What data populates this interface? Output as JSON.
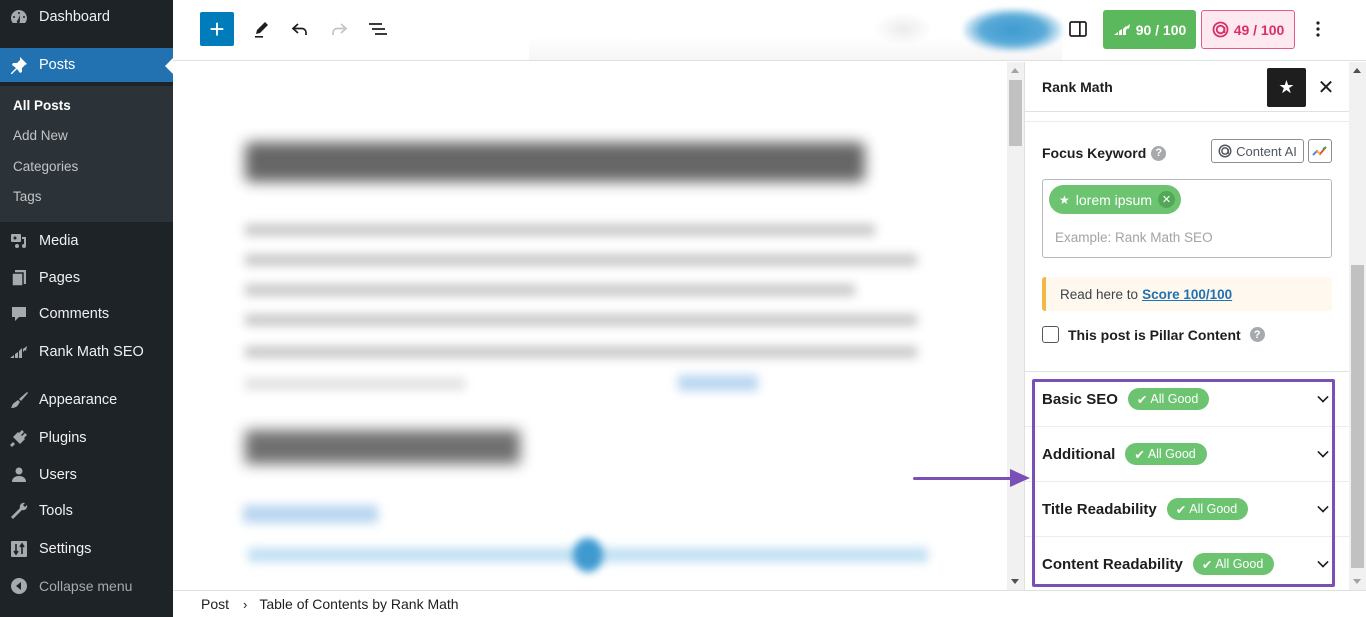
{
  "admin_menu": {
    "items": [
      {
        "label": "Dashboard",
        "icon": "dashboard-icon"
      },
      {
        "label": "Posts",
        "icon": "pin-icon",
        "active": true
      },
      {
        "label": "Media",
        "icon": "media-icon"
      },
      {
        "label": "Pages",
        "icon": "pages-icon"
      },
      {
        "label": "Comments",
        "icon": "comment-icon"
      },
      {
        "label": "Rank Math SEO",
        "icon": "rank-math-icon"
      },
      {
        "label": "Appearance",
        "icon": "paintbrush-icon"
      },
      {
        "label": "Plugins",
        "icon": "plug-icon"
      },
      {
        "label": "Users",
        "icon": "user-icon"
      },
      {
        "label": "Tools",
        "icon": "wrench-icon"
      },
      {
        "label": "Settings",
        "icon": "settings-icon"
      }
    ],
    "posts_submenu": [
      {
        "label": "All Posts",
        "current": true
      },
      {
        "label": "Add New"
      },
      {
        "label": "Categories"
      },
      {
        "label": "Tags"
      }
    ],
    "collapse_label": "Collapse menu"
  },
  "toolbar": {
    "add_block_icon": "plus-icon",
    "tools_icon": "pencil-icon",
    "undo_icon": "undo-icon",
    "redo_icon": "redo-icon",
    "list_view_icon": "list-view-icon",
    "settings_toggle_icon": "sidebar-toggle-icon",
    "seo_score": "90 / 100",
    "content_ai_score": "49 / 100",
    "more_icon": "more-vertical-icon"
  },
  "footer": {
    "breadcrumb": [
      "Post",
      "Table of Contents by Rank Math"
    ],
    "separator": "›"
  },
  "rank_math": {
    "title": "Rank Math",
    "focus_keyword_label": "Focus Keyword",
    "help": "?",
    "content_ai_label": "Content AI",
    "keyword_tag": "lorem ipsum",
    "keyword_placeholder": "Example: Rank Math SEO",
    "notice_prefix": "Read here to",
    "notice_link": "Score 100/100",
    "pillar_label": "This post is Pillar Content",
    "pillar_checked": false,
    "sections": [
      {
        "title": "Basic SEO",
        "status": "All Good"
      },
      {
        "title": "Additional",
        "status": "All Good"
      },
      {
        "title": "Title Readability",
        "status": "All Good"
      },
      {
        "title": "Content Readability",
        "status": "All Good"
      }
    ]
  },
  "colors": {
    "wp_blue": "#2271b1",
    "editor_blue": "#007cba",
    "good_green": "#6cc470",
    "seo_score_green": "#5cb85c",
    "ai_score_pink": "#d6306a",
    "highlight_purple": "#7b4fb8",
    "notice_yellow": "#f0b849"
  }
}
